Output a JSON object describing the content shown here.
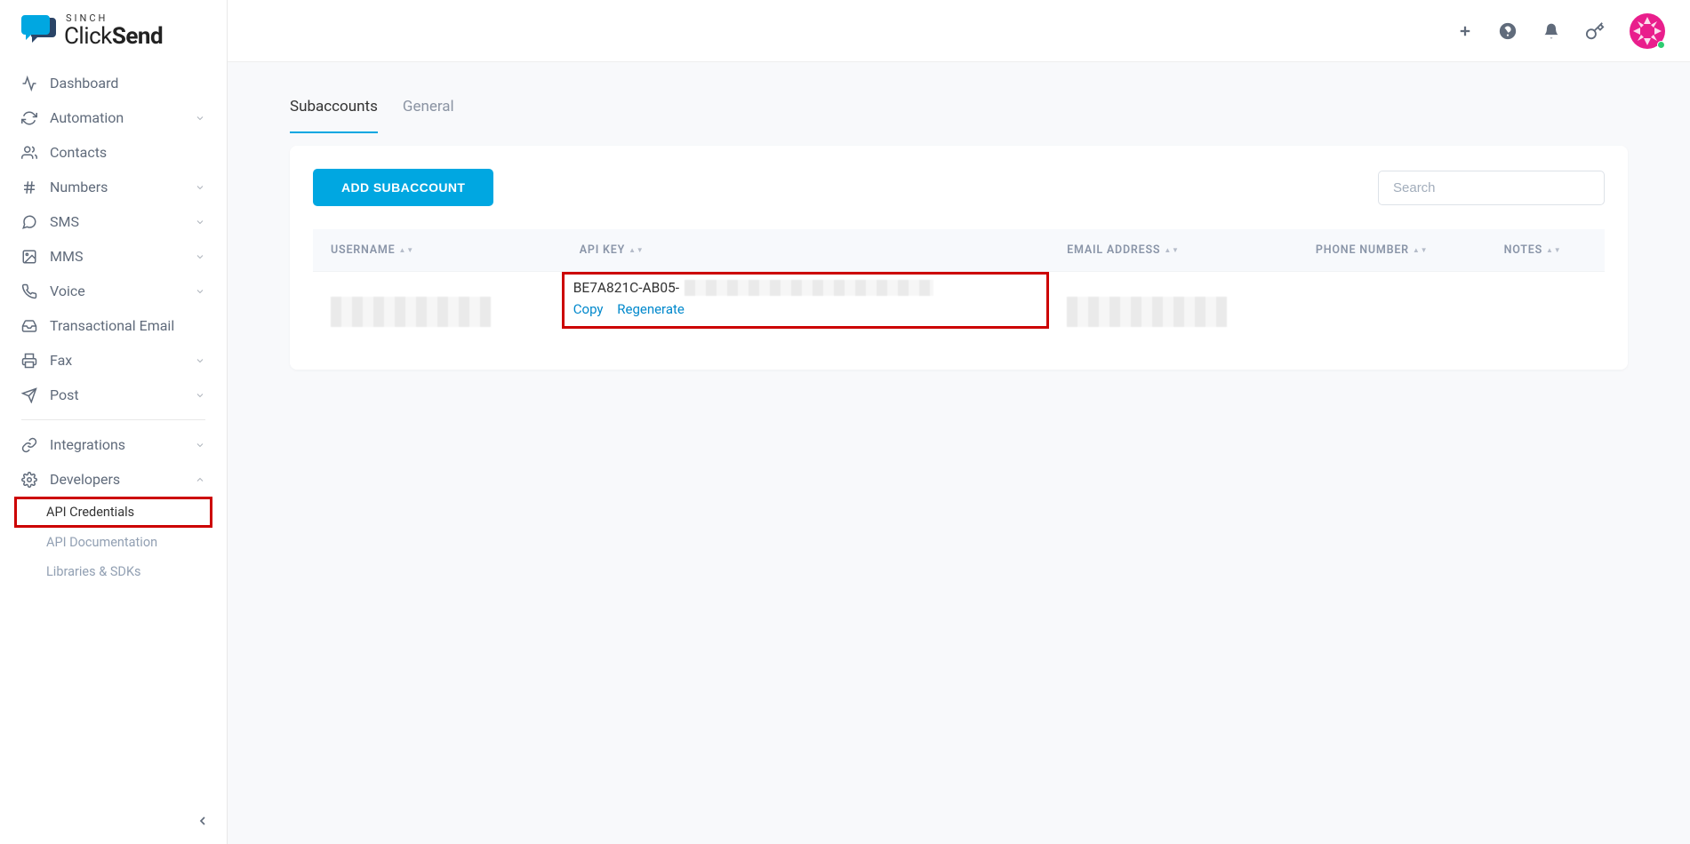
{
  "brand": {
    "top": "SINCH",
    "name_a": "Click",
    "name_b": "Send"
  },
  "sidebar": {
    "items": [
      {
        "label": "Dashboard",
        "icon": "activity",
        "expandable": false
      },
      {
        "label": "Automation",
        "icon": "refresh",
        "expandable": true
      },
      {
        "label": "Contacts",
        "icon": "users",
        "expandable": false
      },
      {
        "label": "Numbers",
        "icon": "hash",
        "expandable": true
      },
      {
        "label": "SMS",
        "icon": "chat",
        "expandable": true
      },
      {
        "label": "MMS",
        "icon": "image",
        "expandable": true
      },
      {
        "label": "Voice",
        "icon": "phone",
        "expandable": true
      },
      {
        "label": "Transactional Email",
        "icon": "inbox",
        "expandable": false
      },
      {
        "label": "Fax",
        "icon": "printer",
        "expandable": true
      },
      {
        "label": "Post",
        "icon": "send",
        "expandable": true
      }
    ],
    "secondary": [
      {
        "label": "Integrations",
        "icon": "link",
        "expandable": true
      },
      {
        "label": "Developers",
        "icon": "gear",
        "expandable": true,
        "open": true
      }
    ],
    "dev_sub": [
      {
        "label": "API Credentials",
        "active": true,
        "highlight": true
      },
      {
        "label": "API Documentation",
        "active": false
      },
      {
        "label": "Libraries & SDKs",
        "active": false
      }
    ]
  },
  "tabs": [
    {
      "label": "Subaccounts",
      "active": true
    },
    {
      "label": "General",
      "active": false
    }
  ],
  "panel": {
    "add_btn": "ADD SUBACCOUNT",
    "search_placeholder": "Search"
  },
  "table": {
    "headers": [
      "USERNAME",
      "API KEY",
      "EMAIL ADDRESS",
      "PHONE NUMBER",
      "NOTES"
    ],
    "row": {
      "api_key_visible": "BE7A821C-AB05-",
      "copy": "Copy",
      "regen": "Regenerate"
    }
  }
}
